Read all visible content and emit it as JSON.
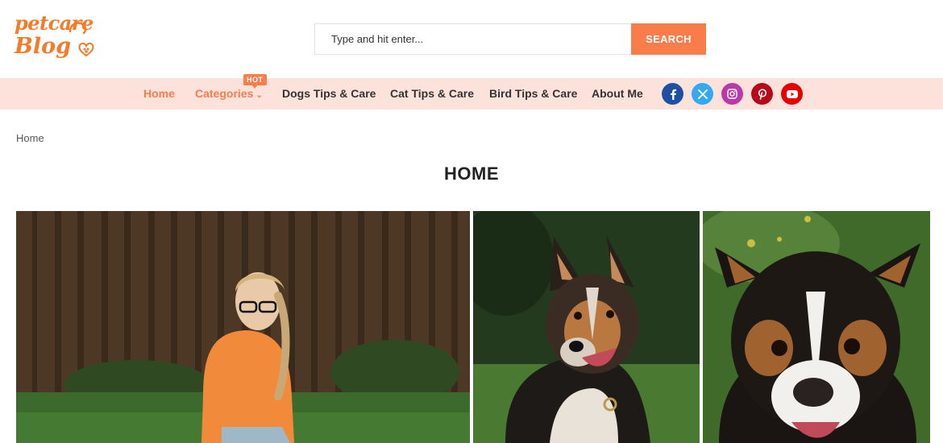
{
  "logo": {
    "line1": "petcare",
    "line2": "Blog"
  },
  "search": {
    "placeholder": "Type and hit enter...",
    "button_label": "SEARCH"
  },
  "nav": {
    "items": [
      {
        "label": "Home",
        "active": true
      },
      {
        "label": "Categories",
        "active": false,
        "badge": "HOT"
      },
      {
        "label": "Dogs Tips & Care",
        "active": false
      },
      {
        "label": "Cat Tips & Care",
        "active": false
      },
      {
        "label": "Bird Tips & Care",
        "active": false
      },
      {
        "label": "About Me",
        "active": false
      }
    ],
    "social": [
      {
        "name": "facebook-icon",
        "color": "#1e4fa3"
      },
      {
        "name": "x-twitter-icon",
        "color": "#33aaf0"
      },
      {
        "name": "instagram-icon",
        "color": "#b93aa6"
      },
      {
        "name": "pinterest-icon",
        "color": "#b7081b"
      },
      {
        "name": "youtube-icon",
        "color": "#e60000"
      }
    ]
  },
  "breadcrumb": "Home",
  "page_title": "HOME",
  "colors": {
    "accent": "#f97d4b",
    "nav_bg": "#fde2dc",
    "logo": "#f47b2a"
  }
}
